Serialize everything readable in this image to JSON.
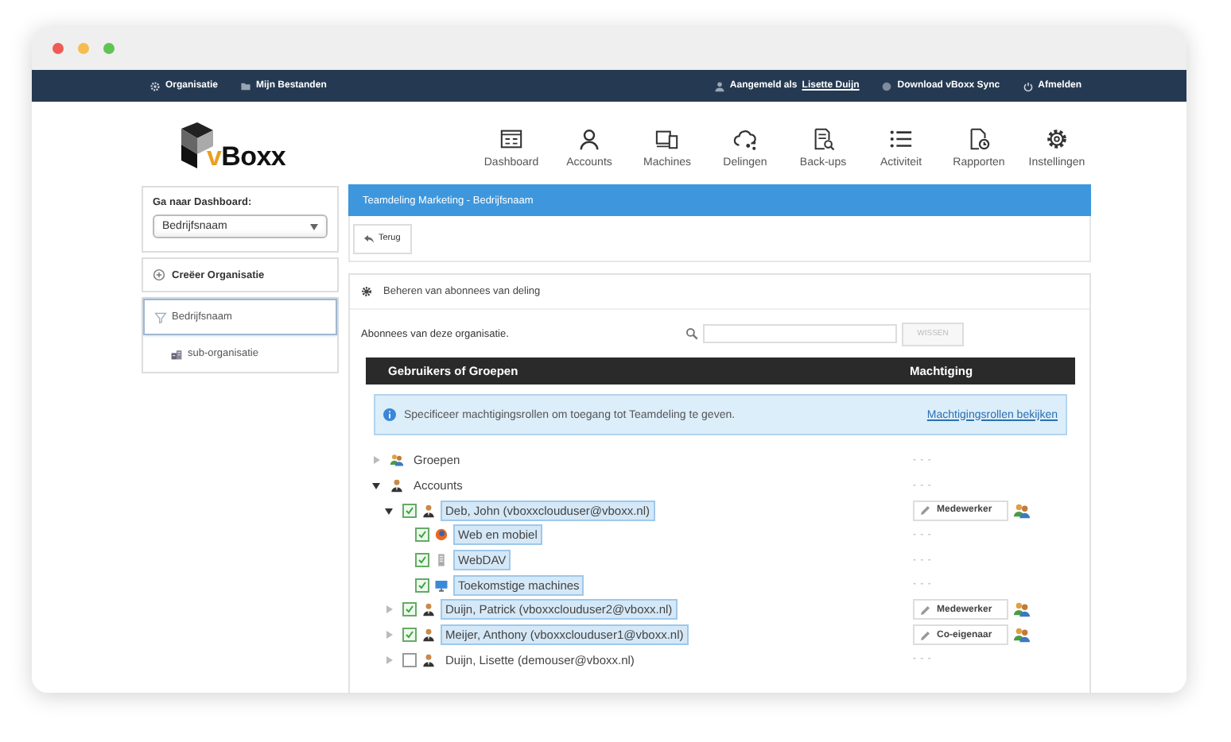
{
  "topbar": {
    "left": [
      {
        "kind": "gear",
        "label": "Organisatie"
      },
      {
        "kind": "folder",
        "label": "Mijn Bestanden"
      }
    ],
    "user": {
      "prefix": "Aangemeld als",
      "name": "Lisette Duijn"
    },
    "right": [
      {
        "kind": "download",
        "label": "Download vBoxx Sync"
      },
      {
        "kind": "power",
        "label": "Afmelden"
      }
    ]
  },
  "logo": {
    "text": "vBoxx"
  },
  "nav": [
    {
      "kind": "dashboard",
      "label": "Dashboard"
    },
    {
      "kind": "accounts",
      "label": "Accounts"
    },
    {
      "kind": "machines",
      "label": "Machines"
    },
    {
      "kind": "shares",
      "label": "Delingen"
    },
    {
      "kind": "backups",
      "label": "Back-ups"
    },
    {
      "kind": "activity",
      "label": "Activiteit"
    },
    {
      "kind": "reports",
      "label": "Rapporten"
    },
    {
      "kind": "settings",
      "label": "Instellingen"
    }
  ],
  "sidebar": {
    "dashboard": {
      "label": "Ga naar Dashboard:",
      "value": "Bedrijfsnaam"
    },
    "create": "Creëer Organisatie",
    "orgs": [
      {
        "kind": "org",
        "label": "Bedrijfsnaam",
        "selected": true,
        "children": [
          {
            "kind": "sub",
            "label": "sub-organisatie",
            "selected": false
          }
        ]
      }
    ]
  },
  "content": {
    "title": "Teamdeling Marketing - Bedrijfsnaam",
    "back": "Terug",
    "section": "Beheren van abonnees van deling",
    "subscribers": "Abonnees van deze organisatie.",
    "clear": {
      "label": "WISSEN",
      "disabled": true
    },
    "columns": [
      "Gebruikers of Groepen",
      "Machtiging"
    ],
    "info": {
      "text": "Specificeer machtigingsrollen om toegang tot Teamdeling te geven.",
      "link": "Machtigingsrollen bekijken"
    },
    "tree": [
      {
        "kind": "group",
        "label": "Groepen",
        "expanded": false,
        "permission": "- - -"
      },
      {
        "kind": "accounts",
        "label": "Accounts",
        "expanded": true,
        "permission": "- - -",
        "children": [
          {
            "kind": "user",
            "label": "Deb, John (vboxxclouduser@vboxx.nl)",
            "expanded": true,
            "checked": true,
            "role": "Medewerker",
            "children": [
              {
                "kind": "web",
                "label": "Web en mobiel",
                "checked": true,
                "permission": "- - -"
              },
              {
                "kind": "webdav",
                "label": "WebDAV",
                "checked": true,
                "permission": "- - -"
              },
              {
                "kind": "machines",
                "label": "Toekomstige machines",
                "checked": true,
                "permission": "- - -"
              }
            ]
          },
          {
            "kind": "user",
            "label": "Duijn, Patrick (vboxxclouduser2@vboxx.nl)",
            "expanded": false,
            "checked": true,
            "role": "Medewerker"
          },
          {
            "kind": "user",
            "label": "Meijer, Anthony (vboxxclouduser1@vboxx.nl)",
            "expanded": false,
            "checked": true,
            "role": "Co-eigenaar"
          },
          {
            "kind": "user",
            "label": "Duijn, Lisette (demouser@vboxx.nl)",
            "expanded": false,
            "checked": false,
            "permission": "- - -"
          }
        ]
      }
    ]
  }
}
